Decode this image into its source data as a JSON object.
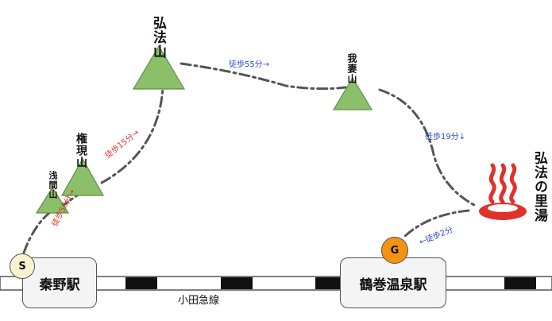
{
  "peaks": {
    "kobo": "弘法山",
    "azuma": "我妻山",
    "gongen": "権現山",
    "sengen": "浅間山"
  },
  "onsen": {
    "name": "弘法の里湯",
    "icon": "hot-spring-icon",
    "color": "#e0312c"
  },
  "routes": {
    "start_to_sengen": "徒歩50分→",
    "gongen_to_kobo": "徒歩15分→",
    "kobo_to_azuma": "徒歩55分→",
    "azuma_to_onsen": "徒歩19分↓",
    "onsen_to_goal": "←徒歩2分"
  },
  "stations": {
    "hadano": "秦野駅",
    "tsurumaki": "鶴巻温泉駅"
  },
  "railway": {
    "name": "小田急線"
  },
  "markers": {
    "start": "S",
    "goal": "G",
    "start_color": "#fbf3cf",
    "goal_color": "#f29411"
  },
  "colors": {
    "mountain": "#8bbf6a",
    "trail": "#555555",
    "walk_red": "#d9342b",
    "walk_blue": "#2a4bc7"
  }
}
